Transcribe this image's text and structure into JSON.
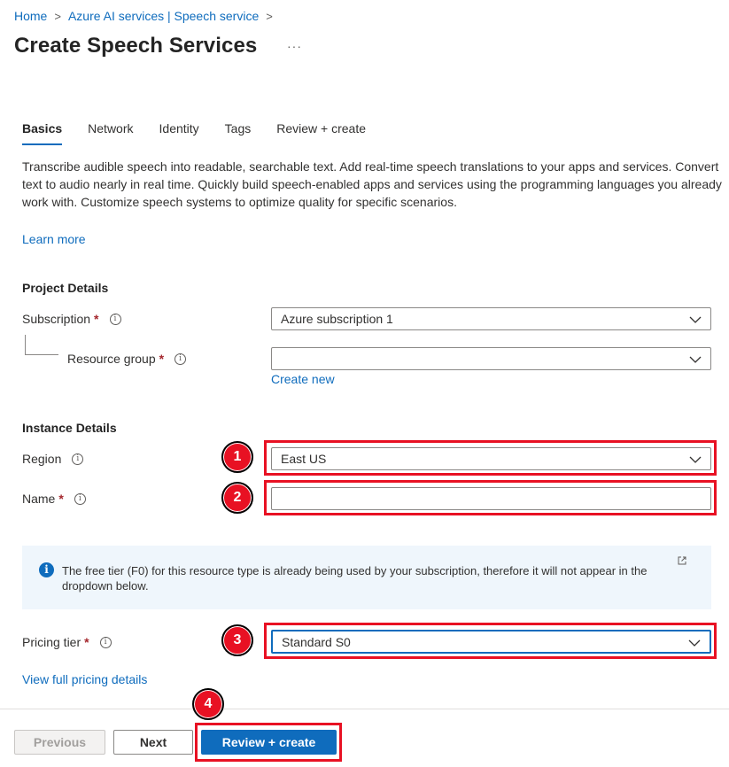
{
  "breadcrumb": {
    "home": "Home",
    "parent": "Azure AI services | Speech service",
    "sep": ">"
  },
  "page": {
    "title": "Create Speech Services",
    "more": "···"
  },
  "tabs": [
    {
      "label": "Basics",
      "active": true
    },
    {
      "label": "Network",
      "active": false
    },
    {
      "label": "Identity",
      "active": false
    },
    {
      "label": "Tags",
      "active": false
    },
    {
      "label": "Review + create",
      "active": false
    }
  ],
  "description": "Transcribe audible speech into readable, searchable text. Add real-time speech translations to your apps and services. Convert text to audio nearly in real time. Quickly build speech-enabled apps and services using the programming languages you already work with. Customize speech systems to optimize quality for specific scenarios.",
  "learn_more": "Learn more",
  "project": {
    "heading": "Project Details",
    "subscription_label": "Subscription",
    "subscription_value": "Azure subscription 1",
    "rg_label": "Resource group",
    "rg_value": "",
    "create_new": "Create new"
  },
  "instance": {
    "heading": "Instance Details",
    "region_label": "Region",
    "region_value": "East US",
    "name_label": "Name",
    "name_value": ""
  },
  "notice": {
    "text": "The free tier (F0) for this resource type is already being used by your subscription, therefore it will not appear in the dropdown below."
  },
  "pricing": {
    "label": "Pricing tier",
    "value": "Standard S0",
    "details_link": "View full pricing details"
  },
  "required_mark": "*",
  "info_glyph": "i",
  "callouts": [
    "1",
    "2",
    "3",
    "4"
  ],
  "footer": {
    "previous": "Previous",
    "next": "Next",
    "create": "Review + create"
  },
  "colors": {
    "accent": "#0f6cbd",
    "callout": "#e81123",
    "required": "#a4262c",
    "notice_bg": "#eff6fc"
  }
}
